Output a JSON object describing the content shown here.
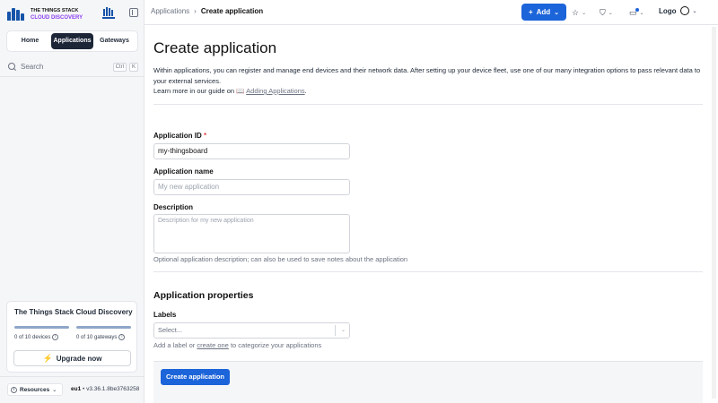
{
  "sidebar": {
    "brand_line1": "THE THINGS STACK",
    "brand_line2": "CLOUD DISCOVERY",
    "tabs": [
      {
        "label": "Home"
      },
      {
        "label": "Applications"
      },
      {
        "label": "Gateways"
      }
    ],
    "search": {
      "label": "Search",
      "kbd1": "Ctrl",
      "kbd2": "K"
    },
    "plan": {
      "title": "The Things Stack Cloud Discovery",
      "devices_label": "0 of 10 devices",
      "gateways_label": "0 of 10 gateways",
      "devices_used": 0,
      "devices_limit": 10,
      "gateways_used": 0,
      "gateways_limit": 10,
      "upgrade_label": "Upgrade now"
    },
    "footer": {
      "resources_label": "Resources",
      "cluster": "eu1",
      "version": "v3.36.1.8be3763258"
    }
  },
  "topbar": {
    "breadcrumb_root": "Applications",
    "breadcrumb_sep": "›",
    "breadcrumb_current": "Create application",
    "add_label": "Add",
    "logo_alt": "Logo"
  },
  "main": {
    "title": "Create application",
    "description": "Within applications, you can register and manage end devices and their network data. After setting up your device fleet, use one of our many integration options to pass relevant data to your external services.",
    "guide_prefix": "Learn more in our guide on",
    "guide_link": "Adding Applications",
    "guide_suffix": ".",
    "app_id_label": "Application ID",
    "app_id_required": "*",
    "app_id_value": "my-thingsboard",
    "app_name_label": "Application name",
    "app_name_placeholder": "My new application",
    "description_label": "Description",
    "description_placeholder": "Description for my new application",
    "description_help": "Optional application description; can also be used to save notes about the application",
    "properties_title": "Application properties",
    "labels_label": "Labels",
    "labels_placeholder": "Select...",
    "labels_help_prefix": "Add a label or",
    "labels_help_link": "create one",
    "labels_help_suffix": "to categorize your applications",
    "create_button": "Create application"
  },
  "colors": {
    "primary": "#1c64d9",
    "active_tab": "#1c2637",
    "brand_purple": "#8a3ff2",
    "notification_dot": "#1c64d9"
  }
}
